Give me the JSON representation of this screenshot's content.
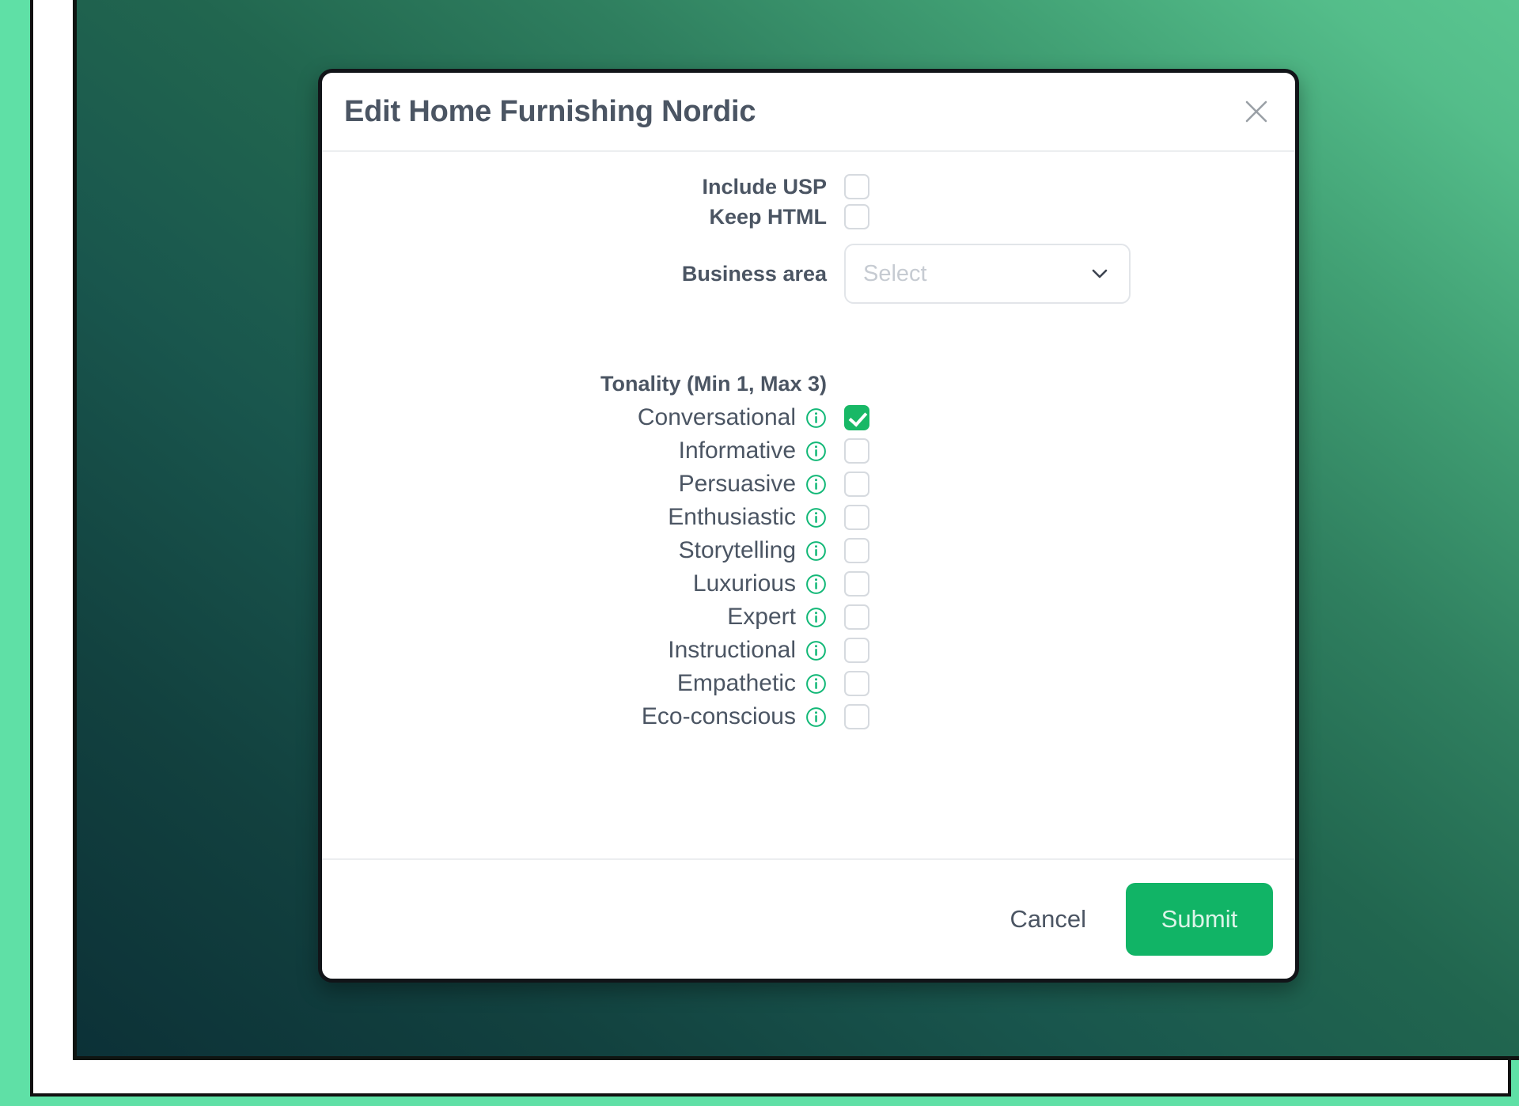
{
  "dialog": {
    "title": "Edit Home Furnishing Nordic",
    "close_icon": "close-icon",
    "fields": [
      {
        "label": "Include USP",
        "type": "checkbox",
        "checked": false
      },
      {
        "label": "Keep HTML",
        "type": "checkbox",
        "checked": false
      },
      {
        "label": "Business area",
        "type": "select",
        "value": "",
        "placeholder": "Select",
        "chevron_icon": "chevron-down-icon"
      }
    ],
    "tonality": {
      "heading": "Tonality (Min 1, Max 3)",
      "info_icon": "info-icon",
      "options": [
        {
          "label": "Conversational",
          "checked": true
        },
        {
          "label": "Informative",
          "checked": false
        },
        {
          "label": "Persuasive",
          "checked": false
        },
        {
          "label": "Enthusiastic",
          "checked": false
        },
        {
          "label": "Storytelling",
          "checked": false
        },
        {
          "label": "Luxurious",
          "checked": false
        },
        {
          "label": "Expert",
          "checked": false
        },
        {
          "label": "Instructional",
          "checked": false
        },
        {
          "label": "Empathetic",
          "checked": false
        },
        {
          "label": "Eco-conscious",
          "checked": false
        }
      ]
    },
    "footer": {
      "cancel_label": "Cancel",
      "submit_label": "Submit"
    }
  },
  "colors": {
    "accent_green": "#11b466",
    "checked_green": "#18b866",
    "info_green": "#12b877",
    "text_slate": "#4b5563",
    "border_gray": "#e2e5e9",
    "backdrop_mint": "#5fe0a6",
    "backdrop_dark_teal": "#0c3137"
  }
}
